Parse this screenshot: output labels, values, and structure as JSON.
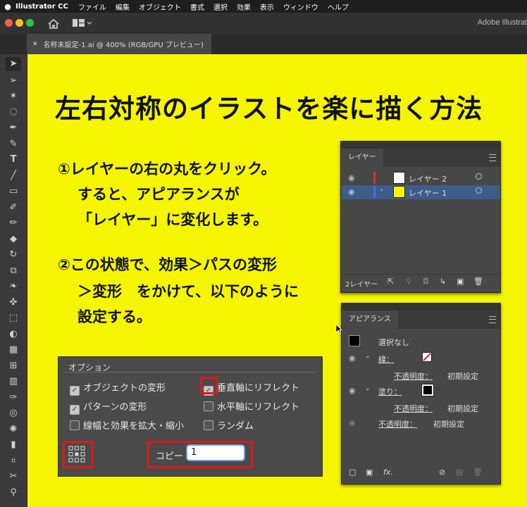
{
  "menubar": {
    "apple": "",
    "app_name": "Illustrator CC",
    "items": [
      "ファイル",
      "編集",
      "オブジェクト",
      "書式",
      "選択",
      "効果",
      "表示",
      "ウィンドウ",
      "ヘルプ"
    ]
  },
  "appbar": {
    "brand": "Adobe Illustrat"
  },
  "document_tab": {
    "close": "✕",
    "title": "名称未設定-1.ai @ 400% (RGB/GPU プレビュー)"
  },
  "headline": "左右対称のイラストを楽に描く方法",
  "step1": {
    "line1": "①レイヤーの右の丸をクリック。",
    "line2": "すると、アピアランスが",
    "line3": "「レイヤー」に変化します。"
  },
  "step2": {
    "line1": "②この状態で、効果＞パスの変形",
    "line2": "＞変形　をかけて、以下のように",
    "line3": "設定する。"
  },
  "layers_panel": {
    "tab": "レイヤー",
    "layers": [
      {
        "name": "レイヤー 2",
        "color": "#e0302e"
      },
      {
        "name": "レイヤー 1",
        "color": "#3c6fe0"
      }
    ],
    "footer": "2レイヤー"
  },
  "appearance_panel": {
    "tab": "アピアランス",
    "selection": "選択なし",
    "stroke_label": "線：",
    "opacity_label": "不透明度：",
    "opacity_value": "初期設定",
    "fill_label": "塗り：",
    "opacity_label2": "不透明度：",
    "opacity_value2": "初期設定",
    "opacity_label3": "不透明度：",
    "opacity_value3": "初期設定",
    "fx": "fx."
  },
  "options": {
    "title": "オプション",
    "transform_objects": "オブジェクトの変形",
    "transform_patterns": "パターンの変形",
    "scale_strokes": "線幅と効果を拡大・縮小",
    "reflect_x": "垂直軸にリフレクト",
    "reflect_y": "水平軸にリフレクト",
    "random": "ランダム",
    "copies_label": "コピー",
    "copies_value": "1"
  }
}
